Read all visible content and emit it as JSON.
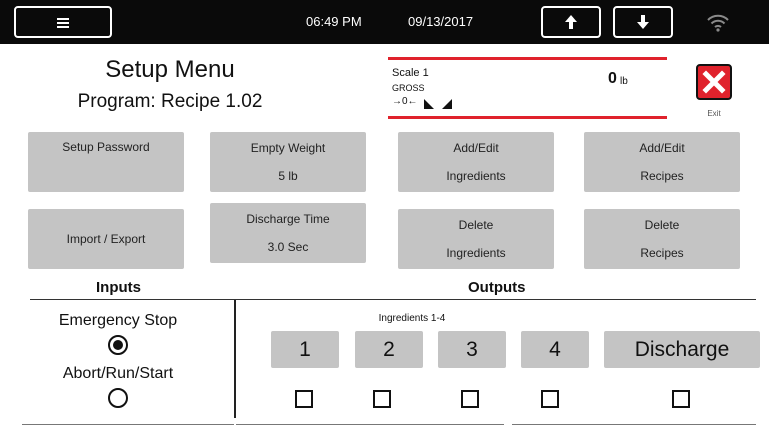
{
  "topbar": {
    "time": "06:49 PM",
    "date": "09/13/2017",
    "icons": {
      "menu": "hamburger-menu-icon",
      "up": "arrow-up-icon",
      "down": "arrow-down-icon",
      "wifi": "wifi-icon"
    }
  },
  "header": {
    "title": "Setup Menu",
    "program": "Program: Recipe 1.02"
  },
  "scale": {
    "name": "Scale 1",
    "mode": "GROSS",
    "zero_indicator": "→0←",
    "value": "0",
    "unit": "lb",
    "accent_color": "#e0222c"
  },
  "exit": {
    "label": "Exit",
    "color": "#e0222c",
    "icon": "close-x-icon"
  },
  "setup_buttons": [
    {
      "line1": "Setup Password",
      "line2": ""
    },
    {
      "line1": "Empty Weight",
      "line2": "5 lb"
    },
    {
      "line1": "Add/Edit",
      "line2": "Ingredients"
    },
    {
      "line1": "Add/Edit",
      "line2": "Recipes"
    },
    {
      "line1": "Import / Export",
      "line2": ""
    },
    {
      "line1": "Discharge Time",
      "line2": "3.0 Sec"
    },
    {
      "line1": "Delete",
      "line2": "Ingredients"
    },
    {
      "line1": "Delete",
      "line2": "Recipes"
    }
  ],
  "inputs": {
    "heading": "Inputs",
    "items": [
      {
        "label": "Emergency Stop",
        "selected": true
      },
      {
        "label": "Abort/Run/Start",
        "selected": false
      }
    ]
  },
  "outputs": {
    "heading": "Outputs",
    "group_label": "Ingredients 1-4",
    "buttons": [
      "1",
      "2",
      "3",
      "4",
      "Discharge"
    ],
    "checked": [
      false,
      false,
      false,
      false,
      false
    ]
  }
}
